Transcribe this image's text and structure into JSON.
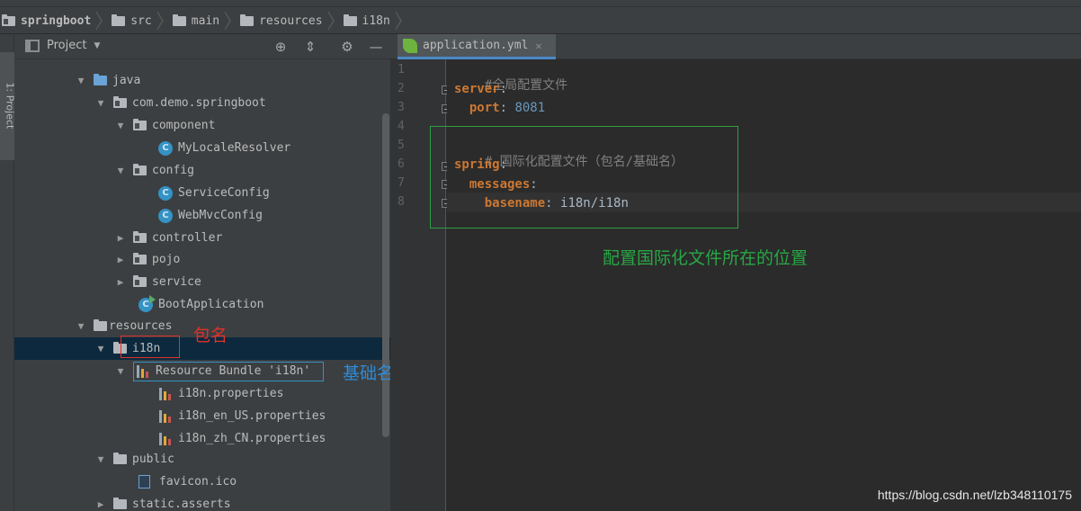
{
  "breadcrumb": [
    "springboot",
    "src",
    "main",
    "resources",
    "i18n"
  ],
  "sidebar_tab_label": "1: Project",
  "project_panel": {
    "title": "Project",
    "caret_icon": "chevron-down-icon",
    "header_icons": [
      "target-icon",
      "collapse-icon",
      "gear-icon",
      "minimize-icon"
    ]
  },
  "tree": [
    {
      "label": "java",
      "icon": "folder-blue-icon",
      "expanded": true
    },
    {
      "label": "com.demo.springboot",
      "icon": "package-icon",
      "expanded": true
    },
    {
      "label": "component",
      "icon": "folder-icon",
      "expanded": true
    },
    {
      "label": "MyLocaleResolver",
      "icon": "class-icon"
    },
    {
      "label": "config",
      "icon": "folder-icon",
      "expanded": true
    },
    {
      "label": "ServiceConfig",
      "icon": "class-icon"
    },
    {
      "label": "WebMvcConfig",
      "icon": "class-icon"
    },
    {
      "label": "controller",
      "icon": "folder-icon",
      "expanded": false
    },
    {
      "label": "pojo",
      "icon": "folder-icon",
      "expanded": false
    },
    {
      "label": "service",
      "icon": "folder-icon",
      "expanded": false
    },
    {
      "label": "BootApplication",
      "icon": "boot-class-icon"
    },
    {
      "label": "resources",
      "icon": "resources-folder-icon",
      "expanded": true
    },
    {
      "label": "i18n",
      "icon": "folder-icon",
      "expanded": true,
      "selected": true
    },
    {
      "label": "Resource Bundle 'i18n'",
      "icon": "resource-bundle-icon",
      "expanded": true
    },
    {
      "label": "i18n.properties",
      "icon": "properties-icon"
    },
    {
      "label": "i18n_en_US.properties",
      "icon": "properties-icon"
    },
    {
      "label": "i18n_zh_CN.properties",
      "icon": "properties-icon"
    },
    {
      "label": "public",
      "icon": "folder-icon",
      "expanded": true
    },
    {
      "label": "favicon.ico",
      "icon": "image-file-icon"
    },
    {
      "label": "static.asserts",
      "icon": "folder-icon",
      "expanded": false
    }
  ],
  "annotations": {
    "package_name": "包名",
    "base_name": "基础名",
    "config_location": "配置国际化文件所在的位置"
  },
  "editor": {
    "tab_label": "application.yml",
    "tab_icon": "spring-leaf-icon",
    "close_icon": "close-icon",
    "line_numbers": [
      "1",
      "2",
      "3",
      "4",
      "5",
      "6",
      "7",
      "8"
    ],
    "lines": {
      "l1": "#全局配置文件",
      "l2_key": "server",
      "l3_key": "port",
      "l3_value": "8081",
      "l5": "# 国际化配置文件（包名/基础名）",
      "l6_key": "spring",
      "l7_key": "messages",
      "l8_key": "basename",
      "l8_value": "i18n/i18n"
    }
  },
  "watermark": "https://blog.csdn.net/lzb348110175",
  "colors": {
    "annotation_red": "#e0312b",
    "annotation_blue": "#2e8bd8",
    "annotation_green": "#28a745",
    "yaml_key": "#cc7832",
    "yaml_number": "#6897bb",
    "comment": "#808080"
  }
}
